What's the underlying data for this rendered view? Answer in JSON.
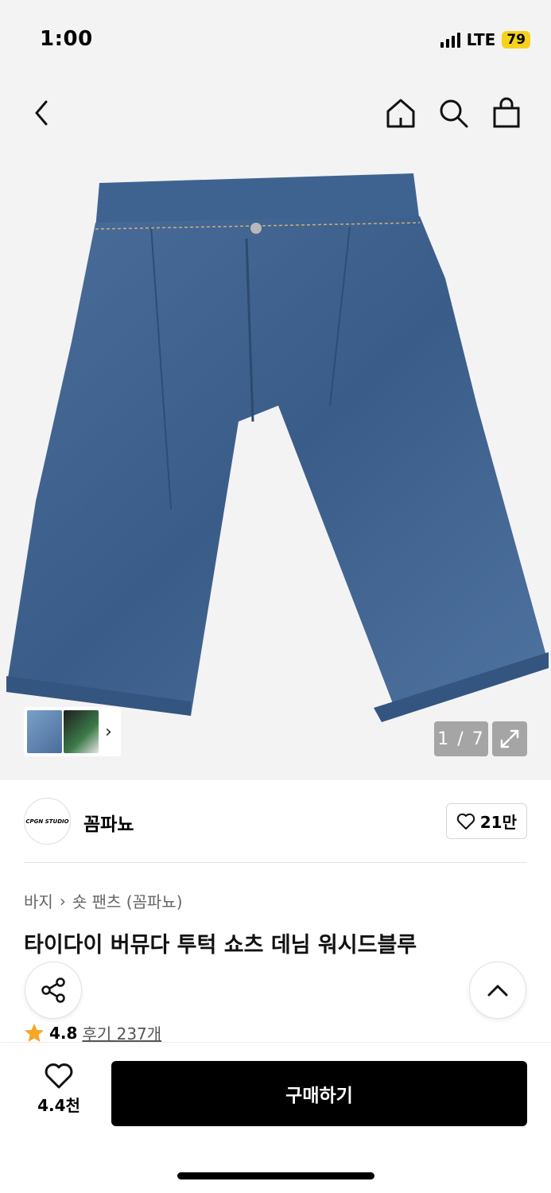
{
  "status_bar": {
    "time": "1:00",
    "network": "LTE",
    "battery": "79"
  },
  "nav": {
    "back_icon": "chevron-left-icon",
    "home_icon": "home-icon",
    "search_icon": "search-icon",
    "cart_icon": "shopping-bag-icon"
  },
  "gallery": {
    "counter": "1 / 7",
    "thumb_arrow": "›"
  },
  "brand": {
    "logo_text": "CPGN STUDIO",
    "name": "꼼파뇨",
    "likes": "21만"
  },
  "breadcrumb": {
    "category": "바지",
    "separator": "›",
    "subcategory": "숏 팬츠 (꼼파뇨)"
  },
  "product": {
    "title": "타이다이 버뮤다 투턱 쇼츠 데님 워시드블루",
    "rating": "4.8",
    "reviews": "후기 237개"
  },
  "bottom_bar": {
    "wish_count": "4.4천",
    "buy_label": "구매하기"
  },
  "colors": {
    "accent": "#000000",
    "star": "#f5a623",
    "battery": "#f5d21d",
    "denim": "#3d5f8c"
  }
}
